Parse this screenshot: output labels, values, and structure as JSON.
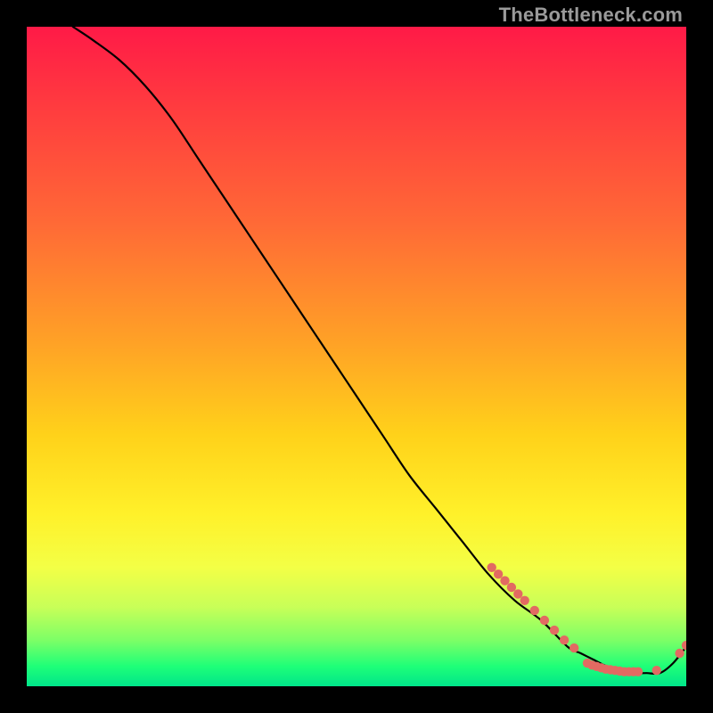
{
  "watermark": "TheBottleneck.com",
  "colors": {
    "gradient_top": "#ff1a47",
    "gradient_mid": "#ffd21a",
    "gradient_bottom": "#00e58a",
    "curve": "#000000",
    "marker": "#e26a62",
    "background": "#000000"
  },
  "chart_data": {
    "type": "line",
    "title": "",
    "xlabel": "",
    "ylabel": "",
    "xlim": [
      0,
      100
    ],
    "ylim": [
      0,
      100
    ],
    "note": "No axes or tick labels are rendered in the image; values are estimated from pixel positions on a 0–100 scale.",
    "series": [
      {
        "name": "curve",
        "color": "#000000",
        "x": [
          7,
          10,
          14,
          18,
          22,
          26,
          30,
          34,
          38,
          42,
          46,
          50,
          54,
          58,
          62,
          66,
          70,
          74,
          78,
          82,
          84,
          86,
          88,
          90,
          92,
          94,
          96,
          98,
          100
        ],
        "y": [
          100,
          98,
          95,
          91,
          86,
          80,
          74,
          68,
          62,
          56,
          50,
          44,
          38,
          32,
          27,
          22,
          17,
          13,
          10,
          6,
          5,
          4,
          3,
          2.5,
          2,
          2,
          2,
          3.5,
          6
        ]
      }
    ],
    "markers": [
      {
        "x": 70.5,
        "y": 18.0
      },
      {
        "x": 71.5,
        "y": 17.0
      },
      {
        "x": 72.5,
        "y": 16.0
      },
      {
        "x": 73.5,
        "y": 15.0
      },
      {
        "x": 74.5,
        "y": 14.0
      },
      {
        "x": 75.5,
        "y": 13.0
      },
      {
        "x": 77.0,
        "y": 11.5
      },
      {
        "x": 78.5,
        "y": 10.0
      },
      {
        "x": 80.0,
        "y": 8.5
      },
      {
        "x": 81.5,
        "y": 7.0
      },
      {
        "x": 83.0,
        "y": 5.8
      },
      {
        "x": 85.0,
        "y": 3.5
      },
      {
        "x": 85.7,
        "y": 3.2
      },
      {
        "x": 86.4,
        "y": 3.0
      },
      {
        "x": 87.1,
        "y": 2.8
      },
      {
        "x": 87.8,
        "y": 2.6
      },
      {
        "x": 88.5,
        "y": 2.5
      },
      {
        "x": 89.2,
        "y": 2.4
      },
      {
        "x": 89.9,
        "y": 2.3
      },
      {
        "x": 90.6,
        "y": 2.2
      },
      {
        "x": 91.3,
        "y": 2.2
      },
      {
        "x": 92.0,
        "y": 2.2
      },
      {
        "x": 92.7,
        "y": 2.2
      },
      {
        "x": 95.5,
        "y": 2.4
      },
      {
        "x": 99.0,
        "y": 5.0
      },
      {
        "x": 100.0,
        "y": 6.2
      }
    ]
  }
}
